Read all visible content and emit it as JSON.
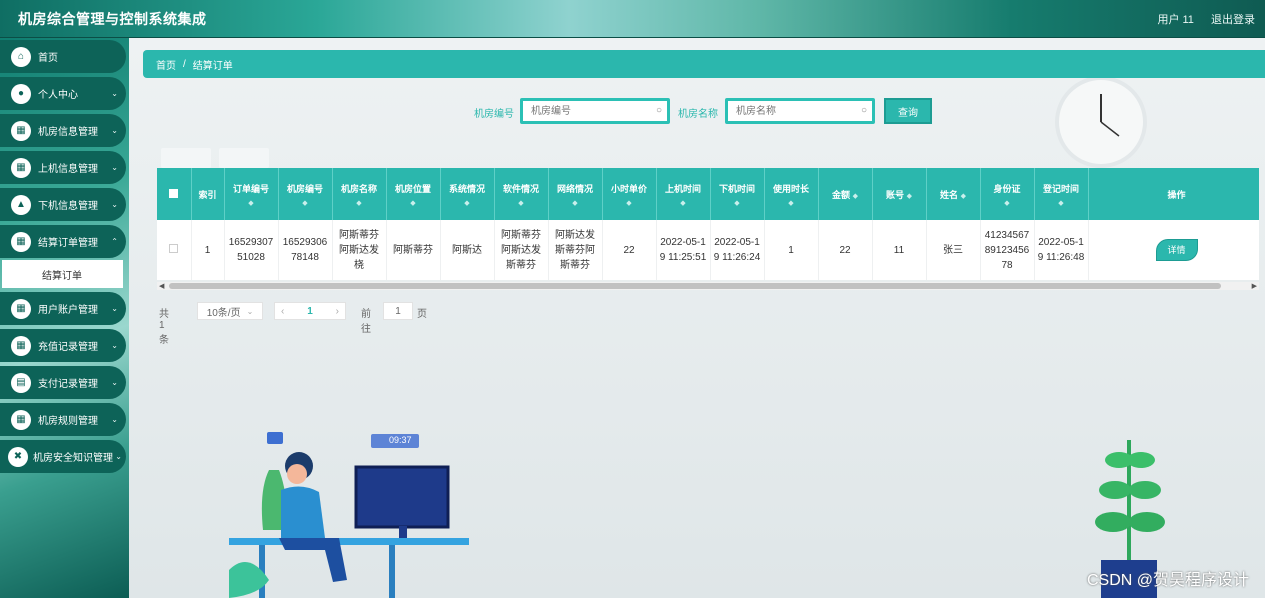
{
  "app": {
    "title": "机房综合管理与控制系统集成",
    "user_label": "用户 11",
    "logout_label": "退出登录"
  },
  "sidebar": {
    "items": [
      {
        "label": "首页",
        "icon": "home-icon",
        "has_arrow": false
      },
      {
        "label": "个人中心",
        "icon": "user-icon",
        "has_arrow": true
      },
      {
        "label": "机房信息管理",
        "icon": "grid-icon",
        "has_arrow": true
      },
      {
        "label": "上机信息管理",
        "icon": "grid-icon",
        "has_arrow": true
      },
      {
        "label": "下机信息管理",
        "icon": "thumb-icon",
        "has_arrow": true
      },
      {
        "label": "结算订单管理",
        "icon": "grid-icon",
        "has_arrow": true
      },
      {
        "label": "用户账户管理",
        "icon": "grid-icon",
        "has_arrow": true
      },
      {
        "label": "充值记录管理",
        "icon": "grid-icon",
        "has_arrow": true
      },
      {
        "label": "支付记录管理",
        "icon": "wallet-icon",
        "has_arrow": true
      },
      {
        "label": "机房规则管理",
        "icon": "grid-icon",
        "has_arrow": true
      },
      {
        "label": "机房安全知识管理",
        "icon": "close-box-icon",
        "has_arrow": true
      }
    ],
    "sub_item": "结算订单"
  },
  "breadcrumb": {
    "home": "首页",
    "separator": "/",
    "current": "结算订单"
  },
  "search": {
    "room_no_label": "机房编号",
    "room_no_placeholder": "机房编号",
    "room_name_label": "机房名称",
    "room_name_placeholder": "机房名称",
    "query_label": "查询"
  },
  "table": {
    "columns": [
      "",
      "索引",
      "订单编号",
      "机房编号",
      "机房名称",
      "机房位置",
      "系统情况",
      "软件情况",
      "网络情况",
      "小时单价",
      "上机时间",
      "下机时间",
      "使用时长",
      "金额",
      "账号",
      "姓名",
      "身份证",
      "登记时间",
      "操作"
    ],
    "rows": [
      {
        "index": "1",
        "order_no": "1652930751028",
        "room_no": "1652930678148",
        "room_name": "阿斯蒂芬阿斯达发桡",
        "room_location": "阿斯蒂芬",
        "system_status": "阿斯达",
        "software_status": "阿斯蒂芬阿斯达发斯蒂芬",
        "network_status": "阿斯达发斯蒂芬阿斯蒂芬",
        "hourly_price": "22",
        "start_time": "2022-05-19 11:25:51",
        "end_time": "2022-05-19 11:26:24",
        "duration": "1",
        "amount": "22",
        "account": "11",
        "name": "张三",
        "id_card": "412345678912345678",
        "register_time": "2022-05-19 11:26:48",
        "action": "详情"
      }
    ]
  },
  "pager": {
    "total": "共 1 条",
    "page_size": "10条/页",
    "current_page": "1",
    "goto_label": "前往",
    "goto_value": "1",
    "page_suffix": "页"
  },
  "illustration": {
    "time": "09:37"
  },
  "watermark": "CSDN @贺昊程序设计",
  "colors": {
    "accent": "#2bb7ad",
    "sidebar_item": "#0d6358"
  }
}
